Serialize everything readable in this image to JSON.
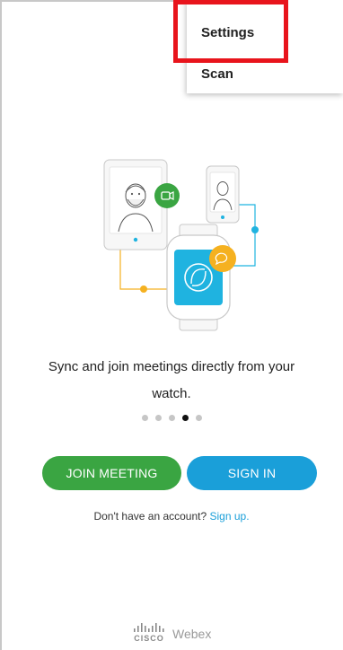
{
  "menu": {
    "items": [
      {
        "label": "Settings"
      },
      {
        "label": "Scan"
      }
    ]
  },
  "onboarding": {
    "tagline_line1": "Sync and join meetings directly from your",
    "tagline_line2": "watch.",
    "pagination": {
      "total": 5,
      "active_index": 3
    }
  },
  "actions": {
    "join_label": "JOIN MEETING",
    "signin_label": "SIGN IN"
  },
  "signup": {
    "prompt": "Don't have an account?",
    "link": "Sign up."
  },
  "brand": {
    "cisco": "CISCO",
    "product": "Webex"
  },
  "colors": {
    "join": "#3aa542",
    "signin": "#1a9fd9",
    "highlight": "#e8141c",
    "watch_screen": "#1fb3e0",
    "chat_bubble": "#f5b120",
    "video_bubble": "#3aa542"
  },
  "icons": [
    "video-icon",
    "chat-bubble-icon",
    "webex-logo-icon",
    "cisco-logo-icon"
  ]
}
